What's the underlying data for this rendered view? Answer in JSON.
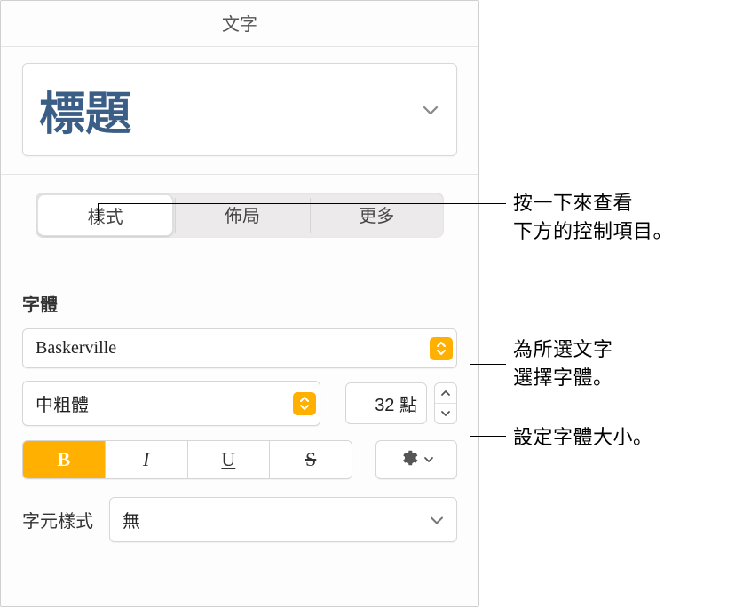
{
  "panel_title": "文字",
  "paragraph_style": {
    "current": "標題"
  },
  "tabs": {
    "items": [
      {
        "label": "樣式",
        "active": true
      },
      {
        "label": "佈局",
        "active": false
      },
      {
        "label": "更多",
        "active": false
      }
    ]
  },
  "font": {
    "section_label": "字體",
    "family": "Baskerville",
    "weight": "中粗體",
    "size_value": "32 點",
    "format_buttons": {
      "bold": "B",
      "italic": "I",
      "underline": "U",
      "strike": "S"
    }
  },
  "char_style": {
    "label": "字元樣式",
    "value": "無"
  },
  "callouts": {
    "tabs": "按一下來查看\n下方的控制項目。",
    "font_family": "為所選文字\n選擇字體。",
    "font_size": "設定字體大小。"
  }
}
